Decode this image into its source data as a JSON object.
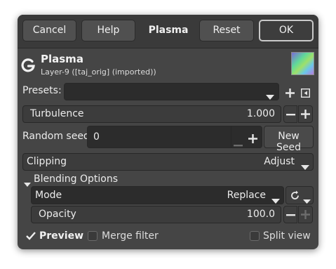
{
  "header": {
    "cancel_label": "Cancel",
    "help_label": "Help",
    "title": "Plasma",
    "reset_label": "Reset",
    "ok_label": "OK"
  },
  "filter": {
    "name": "Plasma",
    "layer": "Layer-9 ([taj_orig] (imported))"
  },
  "presets": {
    "label": "Presets:",
    "value": ""
  },
  "turbulence": {
    "label": "Turbulence",
    "value": "1.000"
  },
  "random_seed": {
    "label": "Random seed",
    "value": "0",
    "new_seed_label": "New Seed"
  },
  "clipping": {
    "label": "Clipping",
    "value": "Adjust"
  },
  "blending": {
    "label": "Blending Options",
    "mode_label": "Mode",
    "mode_value": "Replace",
    "opacity_label": "Opacity",
    "opacity_value": "100.0",
    "opacity_fraction": 1.0
  },
  "footer": {
    "preview_label": "Preview",
    "preview_checked": true,
    "merge_label": "Merge filter",
    "merge_checked": false,
    "split_label": "Split view",
    "split_checked": false
  },
  "icons": {
    "gegl": "gegl-logo-icon",
    "add": "plus-icon",
    "remove": "minus-icon",
    "dropdown": "chevron-down-icon",
    "manage": "preset-menu-icon",
    "reset_mode": "swap-icon",
    "collapse": "triangle-down-icon",
    "check": "checkmark-icon"
  },
  "colors": {
    "dialog_bg": "#454545",
    "header_bg": "#3a3a3a",
    "field_bg": "#2f2f2f",
    "text": "#e6e6e6"
  }
}
